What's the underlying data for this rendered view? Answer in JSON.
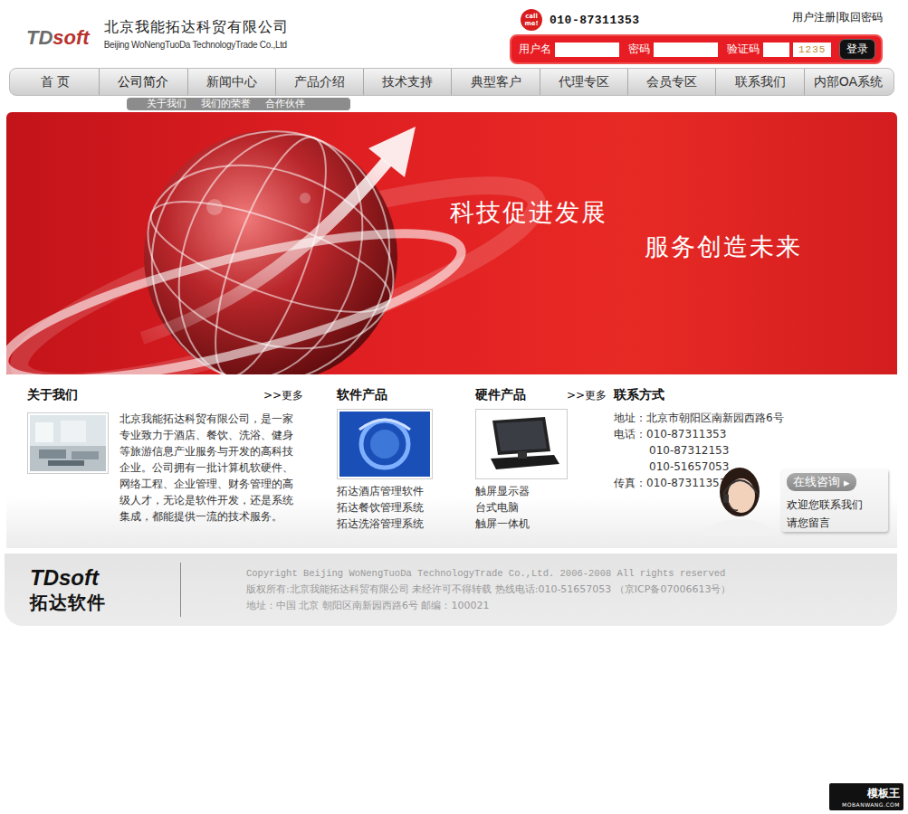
{
  "header": {
    "logo_main": "TD",
    "logo_sub": "soft",
    "company_cn": "北京我能拓达科贸有限公司",
    "company_en": "Beijing WoNengTuoDa TechnologyTrade Co.,Ltd",
    "call_badge": "call me!",
    "phone": "010-87311353",
    "links": [
      "用户注册",
      "取回密码"
    ],
    "link_separator": "|"
  },
  "login": {
    "username_label": "用户名",
    "password_label": "密码",
    "captcha_label": "验证码",
    "captcha_code": "1235",
    "button": "登录"
  },
  "nav": [
    {
      "label": "首 页",
      "expanded": false
    },
    {
      "label": "公司简介",
      "expanded": true
    },
    {
      "label": "新闻中心",
      "expanded": false
    },
    {
      "label": "产品介绍",
      "expanded": false
    },
    {
      "label": "技术支持",
      "expanded": false
    },
    {
      "label": "典型客户",
      "expanded": false
    },
    {
      "label": "代理专区",
      "expanded": false
    },
    {
      "label": "会员专区",
      "expanded": false
    },
    {
      "label": "联系我们",
      "expanded": false
    },
    {
      "label": "内部OA系统",
      "expanded": false
    }
  ],
  "subnav": [
    "关于我们",
    "我们的荣誉",
    "合作伙伴"
  ],
  "banner": {
    "slogans": [
      "科技促进发展",
      "服务创造未来"
    ]
  },
  "about": {
    "title": "关于我们",
    "more": ">>更多",
    "text": "北京我能拓达科贸有限公司，是一家专业致力于酒店、餐饮、洗浴、健身等旅游信息产业服务与开发的高科技企业。公司拥有一批计算机软硬件、网络工程、企业管理、财务管理的高级人才，无论是软件开发，还是系统集成，都能提供一流的技术服务。"
  },
  "software": {
    "title": "软件产品",
    "items": [
      "拓达酒店管理软件",
      "拓达餐饮管理系统",
      "拓达洗浴管理系统"
    ]
  },
  "hardware": {
    "title": "硬件产品",
    "more": ">>更多",
    "items": [
      "触屏显示器",
      "台式电脑",
      "触屏一体机"
    ]
  },
  "contact": {
    "title": "联系方式",
    "address": "地址：北京市朝阳区南新园西路6号",
    "phone_label": "电话：",
    "phones": [
      "010-87311353",
      "010-87312153",
      "010-51657053"
    ],
    "fax": "传真：010-87311353"
  },
  "consult": {
    "button": "在线咨询",
    "arrow": "▸",
    "lines": [
      "欢迎您联系我们",
      "请您留言"
    ]
  },
  "footer": {
    "logo_main": "TD",
    "logo_sub": "soft",
    "logo_cn": "拓达软件",
    "lines": [
      "Copyright  Beijing WoNengTuoDa TechnologyTrade Co.,Ltd. 2006-2008 All rights reserved",
      "版权所有:北京我能拓达科贸有限公司 未经许可不得转载  热线电话:010-51657053  （京ICP备07006613号）",
      "地址：中国 北京 朝阳区南新园西路6号    邮编：100021"
    ]
  },
  "watermark": {
    "cn": "模板王",
    "url": "MOBANWANG.COM"
  }
}
